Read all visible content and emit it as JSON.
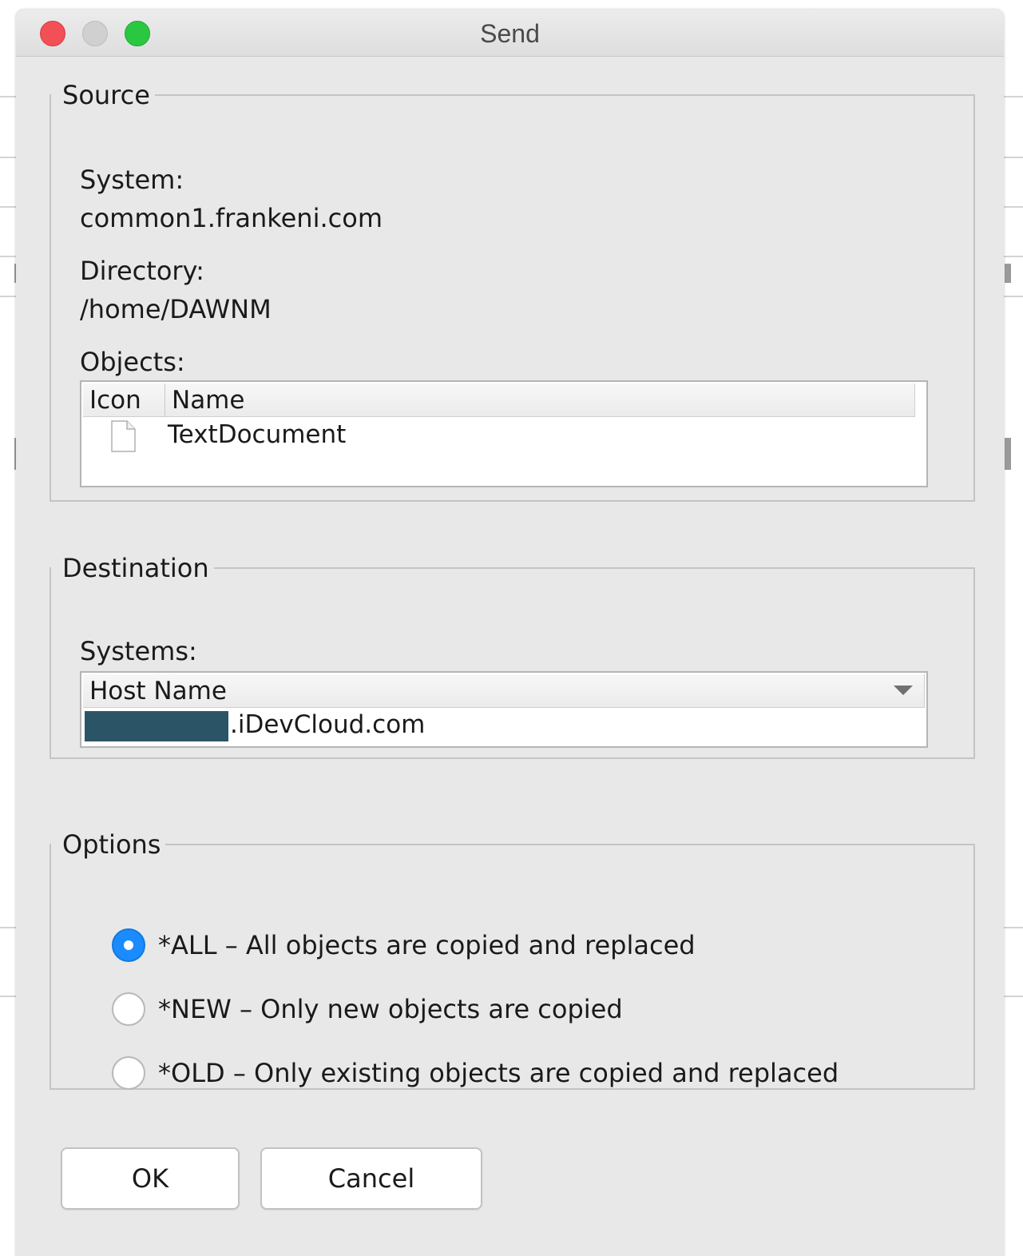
{
  "window": {
    "title": "Send"
  },
  "source": {
    "legend": "Source",
    "system_label": "System:",
    "system_value": "common1.frankeni.com",
    "directory_label": "Directory:",
    "directory_value": "/home/DAWNM",
    "objects_label": "Objects:",
    "objects_table": {
      "columns": [
        "Icon",
        "Name"
      ],
      "rows": [
        {
          "icon": "document-icon",
          "name": "TextDocument"
        }
      ]
    }
  },
  "destination": {
    "legend": "Destination",
    "systems_label": "Systems:",
    "systems_table": {
      "column": "Host Name",
      "rows": [
        {
          "host_suffix": ".iDevCloud.com"
        }
      ]
    }
  },
  "options": {
    "legend": "Options",
    "items": [
      {
        "label": "*ALL – All objects are copied and replaced",
        "checked": true
      },
      {
        "label": "*NEW – Only new objects are copied",
        "checked": false
      },
      {
        "label": "*OLD – Only existing objects are copied and replaced",
        "checked": false
      }
    ]
  },
  "buttons": {
    "ok": "OK",
    "cancel": "Cancel"
  },
  "colors": {
    "accent": "#1a8cff",
    "close": "#f25056",
    "maximize": "#2ac840",
    "redaction": "#2b5566"
  }
}
